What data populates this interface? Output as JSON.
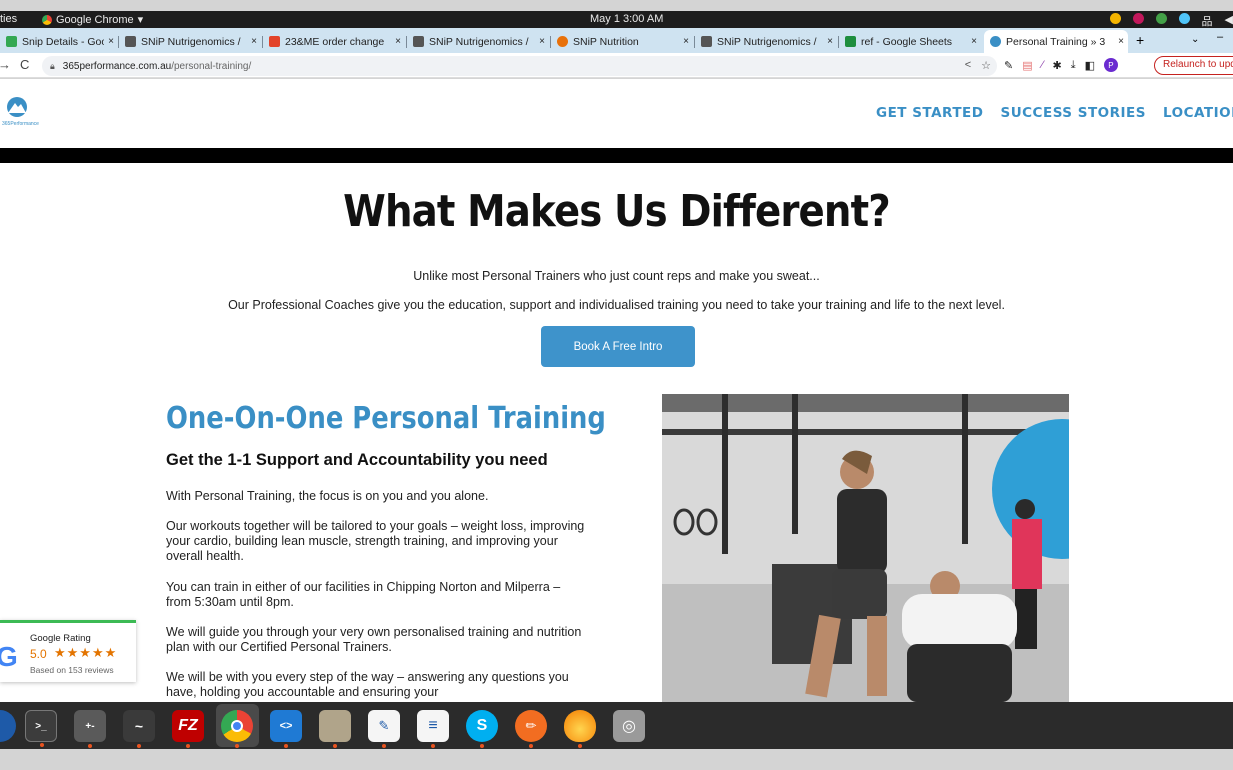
{
  "system": {
    "activities": "ties",
    "app_name": "Google Chrome",
    "clock": "May 1  3:00 AM"
  },
  "tabs": [
    {
      "title": "Snip Details - Google",
      "icon_color": "#34a853"
    },
    {
      "title": "SNiP Nutrigenomics /",
      "icon_color": "#555555"
    },
    {
      "title": "23&ME order change",
      "icon_color": "#e2432a"
    },
    {
      "title": "SNiP Nutrigenomics /",
      "icon_color": "#555555"
    },
    {
      "title": "SNiP Nutrition",
      "icon_color": "#e8710a"
    },
    {
      "title": "SNiP Nutrigenomics /",
      "icon_color": "#555555"
    },
    {
      "title": "ref - Google Sheets",
      "icon_color": "#1e8e3e"
    },
    {
      "title": "Personal Training » 3",
      "icon_color": "#3a8fc5"
    }
  ],
  "address": {
    "domain": "365performance.com.au",
    "path": "/personal-training/",
    "relaunch": "Relaunch to upd"
  },
  "site": {
    "logo_text": "365Performance",
    "nav": [
      "GET STARTED",
      "SUCCESS STORIES",
      "LOCATIONS"
    ],
    "hero_title": "What Makes Us Different?",
    "hero_sub1": "Unlike most Personal Trainers who just count reps and make you sweat...",
    "hero_sub2": "Our Professional Coaches give you the education, support and individualised training you need to take your training and life to the next level.",
    "cta": "Book A Free Intro",
    "section_title": "One-On-One Personal Training",
    "section_sub": "Get the 1-1 Support and Accountability you need",
    "paragraphs": [
      "With Personal Training, the focus is on you and you alone.",
      "Our workouts together will be tailored to your goals – weight loss, improving your cardio, building lean muscle, strength training, and improving your overall health.",
      "You can train in either of our facilities in Chipping Norton and Milperra – from 5:30am until 8pm.",
      "We will guide you through your very own personalised training and nutrition plan with our Certified Personal Trainers.",
      "We will be with you every step of the way – answering any questions you have, holding you accountable and ensuring your"
    ]
  },
  "rating": {
    "label": "Google Rating",
    "score": "5.0",
    "stars": "★★★★★",
    "based_on": "Based on 153 reviews"
  },
  "dock": [
    {
      "name": "terminal",
      "glyph": ">_"
    },
    {
      "name": "calculator",
      "glyph": "+-"
    },
    {
      "name": "system-monitor",
      "glyph": "~"
    },
    {
      "name": "filezilla",
      "glyph": "FZ"
    },
    {
      "name": "chrome",
      "glyph": ""
    },
    {
      "name": "vscode",
      "glyph": "<>"
    },
    {
      "name": "files",
      "glyph": ""
    },
    {
      "name": "text-editor",
      "glyph": "✎"
    },
    {
      "name": "writer",
      "glyph": "≡"
    },
    {
      "name": "skype",
      "glyph": "S"
    },
    {
      "name": "pencil-app",
      "glyph": "✏"
    },
    {
      "name": "flame-app",
      "glyph": ""
    },
    {
      "name": "disk-app",
      "glyph": "◎"
    }
  ]
}
